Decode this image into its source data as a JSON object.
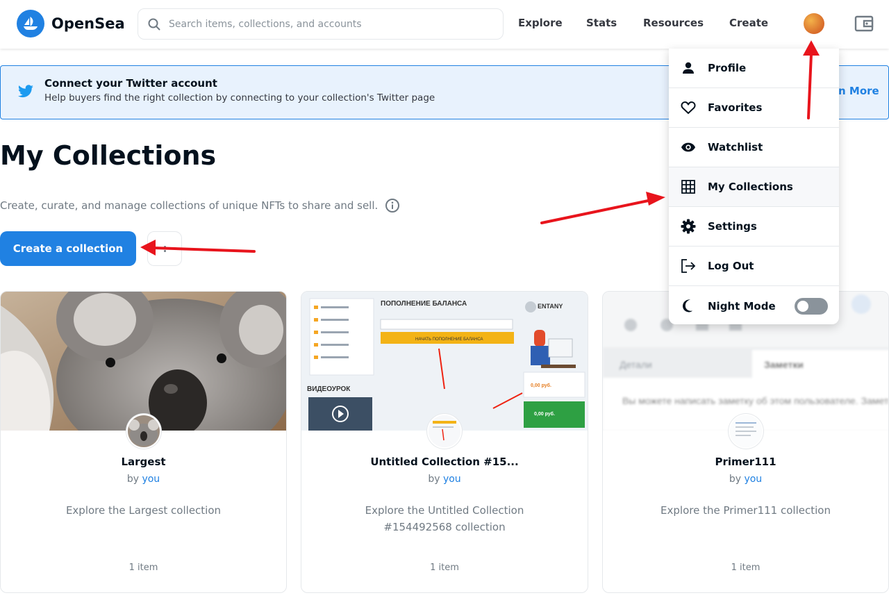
{
  "brand": {
    "name": "OpenSea",
    "accent": "#2081e2"
  },
  "search": {
    "placeholder": "Search items, collections, and accounts"
  },
  "nav": {
    "explore": "Explore",
    "stats": "Stats",
    "resources": "Resources",
    "create": "Create"
  },
  "banner": {
    "title": "Connect your Twitter account",
    "text": "Help buyers find the right collection by connecting to your collection's Twitter page",
    "more": "n More"
  },
  "page": {
    "title": "My Collections",
    "subtitle": "Create, curate, and manage collections of unique NFTs to share and sell.",
    "create_button": "Create a collection"
  },
  "collections": [
    {
      "name": "Largest",
      "by_prefix": "by",
      "by_user": "you",
      "description": "Explore the Largest collection",
      "count": "1 item"
    },
    {
      "name": "Untitled Collection #15...",
      "by_prefix": "by",
      "by_user": "you",
      "description": "Explore the Untitled Collection #154492568 collection",
      "count": "1 item",
      "banner_text": {
        "heading": "ПОПОЛНЕНИЕ БАЛАНСА",
        "button": "НАЧАТЬ ПОПОЛНЕНИЕ БАЛАНСА",
        "user": "ENTANY",
        "video": "ВИДЕОУРОК",
        "balance1": "0,00 руб.",
        "balance2": "0,00 руб."
      }
    },
    {
      "name": "Primer111",
      "by_prefix": "by",
      "by_user": "you",
      "description": "Explore the Primer111 collection",
      "count": "1 item",
      "banner_text": {
        "tab1": "Детали",
        "tab2": "Заметки",
        "body": "Вы можете написать заметку об этом пользователе. Заметку будет видна только"
      }
    }
  ],
  "menu": {
    "items": [
      {
        "label": "Profile",
        "icon": "person-icon"
      },
      {
        "label": "Favorites",
        "icon": "heart-icon"
      },
      {
        "label": "Watchlist",
        "icon": "eye-icon"
      },
      {
        "label": "My Collections",
        "icon": "grid-icon"
      },
      {
        "label": "Settings",
        "icon": "gear-icon"
      },
      {
        "label": "Log Out",
        "icon": "logout-icon"
      },
      {
        "label": "Night Mode",
        "icon": "moon-icon"
      }
    ],
    "night_mode_on": false
  }
}
